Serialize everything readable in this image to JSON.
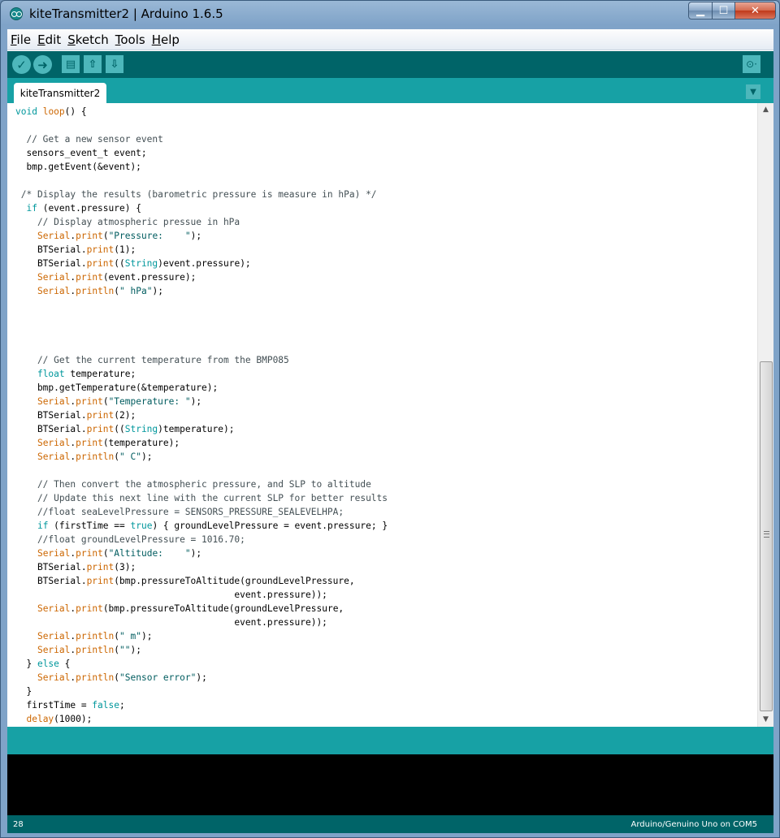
{
  "window": {
    "title": "kiteTransmitter2 | Arduino 1.6.5"
  },
  "menu": [
    {
      "key": "F",
      "rest": "ile"
    },
    {
      "key": "E",
      "rest": "dit"
    },
    {
      "key": "S",
      "rest": "ketch"
    },
    {
      "key": "T",
      "rest": "ools"
    },
    {
      "key": "H",
      "rest": "elp"
    }
  ],
  "toolbar": {
    "verify_icon": "check-icon",
    "upload_icon": "arrow-right-icon",
    "new_icon": "new-file-icon",
    "open_icon": "open-icon",
    "save_icon": "save-icon",
    "serial_icon": "serial-monitor-icon"
  },
  "tabs": [
    {
      "label": "kiteTransmitter2"
    }
  ],
  "code": [
    "void loop() {",
    "",
    "  // Get a new sensor event",
    "  sensors_event_t event;",
    "  bmp.getEvent(&event);",
    "",
    " /* Display the results (barometric pressure is measure in hPa) */",
    "  if (event.pressure) {",
    "    // Display atmospheric pressue in hPa",
    "    Serial.print(\"Pressure:    \");",
    "    BTSerial.print(1);",
    "    BTSerial.print((String)event.pressure);",
    "    Serial.print(event.pressure);",
    "    Serial.println(\" hPa\");",
    "",
    "",
    "",
    "",
    "    // Get the current temperature from the BMP085",
    "    float temperature;",
    "    bmp.getTemperature(&temperature);",
    "    Serial.print(\"Temperature: \");",
    "    BTSerial.print(2);",
    "    BTSerial.print((String)temperature);",
    "    Serial.print(temperature);",
    "    Serial.println(\" C\");",
    "",
    "    // Then convert the atmospheric pressure, and SLP to altitude",
    "    // Update this next line with the current SLP for better results",
    "    //float seaLevelPressure = SENSORS_PRESSURE_SEALEVELHPA;",
    "    if (firstTime == true) { groundLevelPressure = event.pressure; }",
    "    //float groundLevelPressure = 1016.70;",
    "    Serial.print(\"Altitude:    \");",
    "    BTSerial.print(3);",
    "    BTSerial.print(bmp.pressureToAltitude(groundLevelPressure,",
    "                                        event.pressure));",
    "    Serial.print(bmp.pressureToAltitude(groundLevelPressure,",
    "                                        event.pressure));",
    "    Serial.println(\" m\");",
    "    Serial.println(\"\");",
    "  } else {",
    "    Serial.println(\"Sensor error\");",
    "  }",
    "  firstTime = false;",
    "  delay(1000);",
    "}"
  ],
  "status": {
    "line": "28",
    "board": "Arduino/Genuino Uno on COM5"
  },
  "colors": {
    "toolbar": "#006468",
    "tabbar": "#17a1a5",
    "button": "#4db7bb",
    "keyword": "#cc6600",
    "type": "#00979c",
    "string": "#005c5f",
    "comment": "#434f54"
  }
}
